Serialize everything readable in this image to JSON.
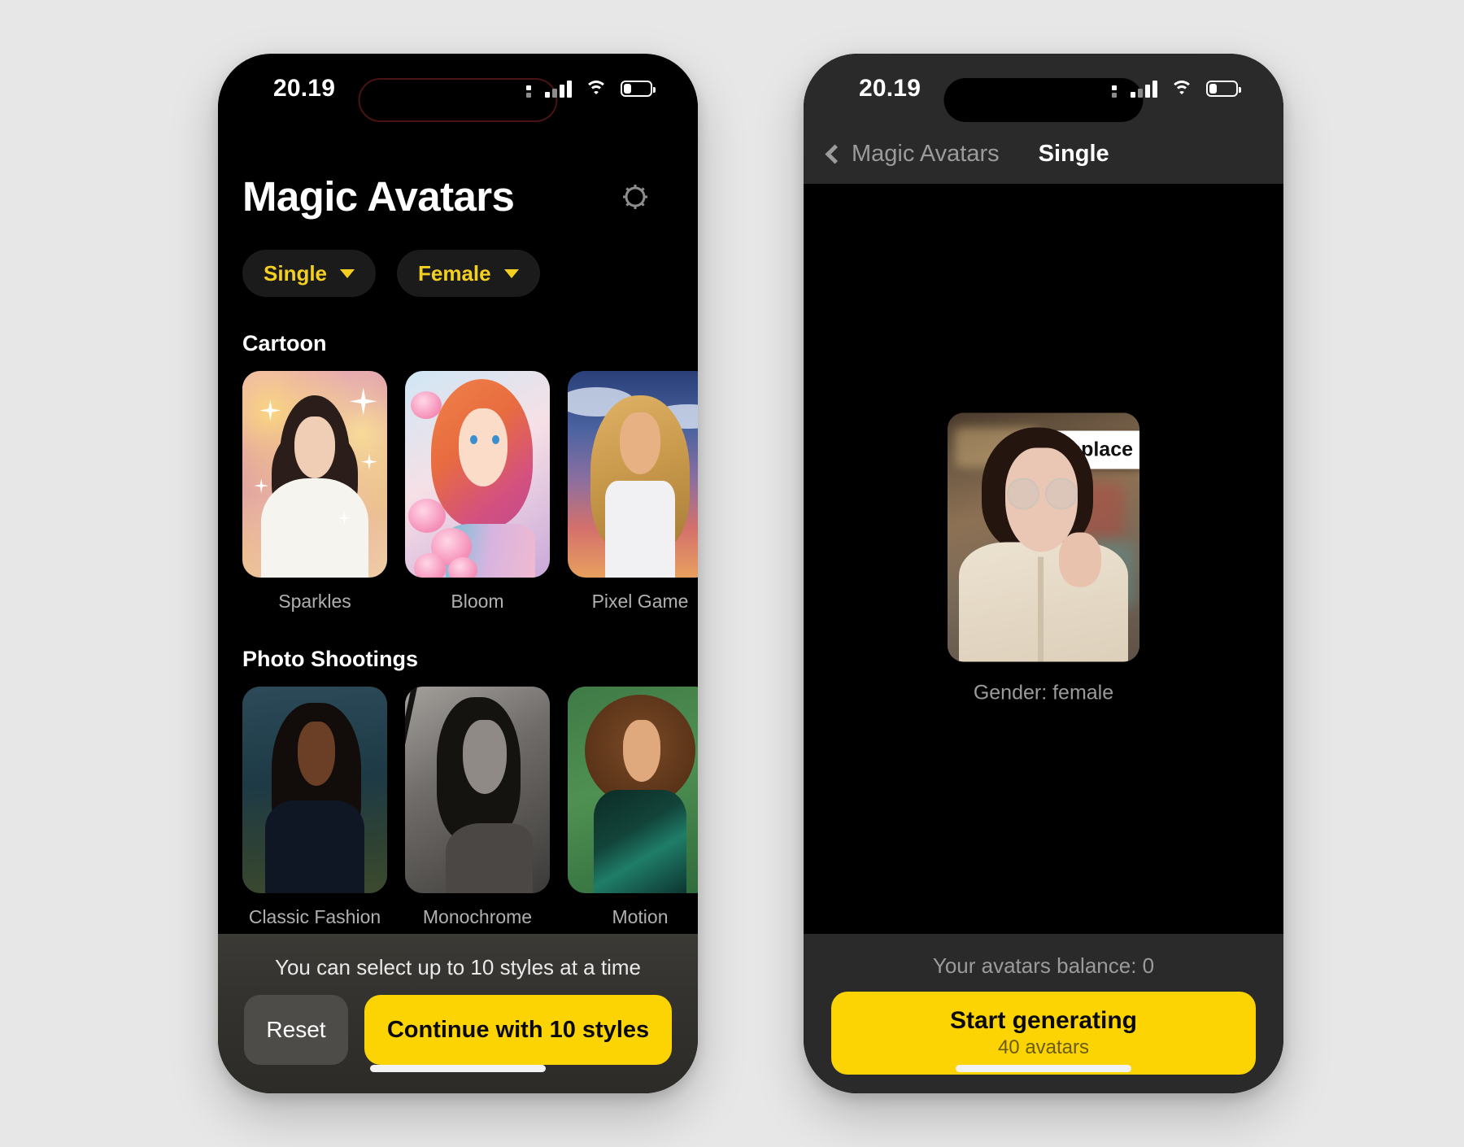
{
  "page": {
    "background_color": "#e7e7e7"
  },
  "phone_left": {
    "status": {
      "time": "20.19",
      "cellular_icon": "signal-bars-icon",
      "wifi_icon": "wifi-icon",
      "battery_icon": "battery-low-icon"
    },
    "header": {
      "title": "Magic Avatars",
      "settings_icon": "gear-icon"
    },
    "filters": [
      {
        "label": "Single",
        "icon": "chevron-down-icon"
      },
      {
        "label": "Female",
        "icon": "chevron-down-icon"
      }
    ],
    "sections": [
      {
        "title": "Cartoon",
        "cards": [
          {
            "label": "Sparkles",
            "selected": false
          },
          {
            "label": "Bloom",
            "selected": false
          },
          {
            "label": "Pixel Game",
            "selected": false
          }
        ]
      },
      {
        "title": "Photo Shootings",
        "cards": [
          {
            "label": "Classic Fashion",
            "selected": true,
            "badge": "check-icon"
          },
          {
            "label": "Monochrome",
            "selected": true,
            "badge": "check-icon"
          },
          {
            "label": "Motion",
            "selected": false
          }
        ]
      }
    ],
    "footer": {
      "hint": "You can select up to 10 styles at a time",
      "reset_label": "Reset",
      "continue_label": "Continue with 10 styles"
    }
  },
  "phone_right": {
    "status": {
      "time": "20.19",
      "cellular_icon": "signal-bars-icon",
      "wifi_icon": "wifi-icon",
      "battery_icon": "battery-low-icon"
    },
    "navbar": {
      "back_icon": "chevron-left-icon",
      "back_label": "Magic Avatars",
      "title": "Single"
    },
    "content": {
      "replace_label": "Replace",
      "gender_label": "Gender: female",
      "photo_alt": "user-portrait"
    },
    "footer": {
      "balance": "Your avatars balance: 0",
      "generate_title": "Start generating",
      "generate_sub": "40 avatars"
    }
  },
  "colors": {
    "accent_yellow": "#fcd404",
    "chip_text_yellow": "#f2cf20",
    "screen_black": "#000000",
    "bar_gray": "#2a2a2a",
    "muted_text": "#9b9b9b"
  }
}
